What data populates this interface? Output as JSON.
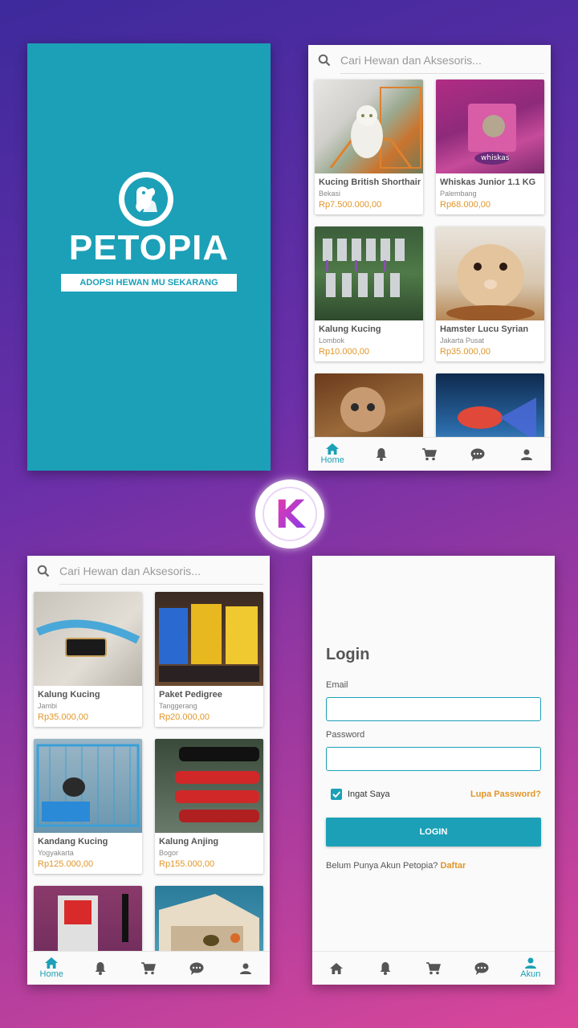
{
  "splash": {
    "title": "PETOPIA",
    "tagline": "ADOPSI HEWAN MU SEKARANG"
  },
  "search": {
    "placeholder": "Cari Hewan dan Aksesoris..."
  },
  "shop_a": {
    "products": [
      {
        "name": "Kucing British Shorthair",
        "city": "Bekasi",
        "price": "Rp7.500.000,00"
      },
      {
        "name": "Whiskas Junior 1.1 KG",
        "city": "Palembang",
        "price": "Rp68.000,00"
      },
      {
        "name": "Kalung Kucing",
        "city": "Lombok",
        "price": "Rp10.000,00"
      },
      {
        "name": "Hamster Lucu Syrian",
        "city": "Jakarta Pusat",
        "price": "Rp35.000,00"
      }
    ]
  },
  "shop_b": {
    "products": [
      {
        "name": "Kalung Kucing",
        "city": "Jambi",
        "price": "Rp35.000,00"
      },
      {
        "name": "Paket Pedigree",
        "city": "Tanggerang",
        "price": "Rp20.000,00"
      },
      {
        "name": "Kandang Kucing",
        "city": "Yogyakarta",
        "price": "Rp125.000,00"
      },
      {
        "name": "Kalung Anjing",
        "city": "Bogor",
        "price": "Rp155.000,00"
      }
    ]
  },
  "nav": {
    "home_label": "Home",
    "account_label": "Akun",
    "icons": [
      "home-icon",
      "bell-icon",
      "cart-icon",
      "chat-icon",
      "user-icon"
    ]
  },
  "login": {
    "title": "Login",
    "email_label": "Email",
    "password_label": "Password",
    "remember_label": "Ingat Saya",
    "remember_checked": true,
    "forgot_label": "Lupa Password?",
    "button_label": "LOGIN",
    "register_prompt": "Belum Punya Akun Petopia?",
    "register_link": "Daftar"
  },
  "colors": {
    "primary": "#1ba0b7",
    "accent": "#e0962a",
    "badge_gradient": [
      "#f03aa6",
      "#7b3cf0"
    ]
  },
  "badge": {
    "letter": "K"
  }
}
